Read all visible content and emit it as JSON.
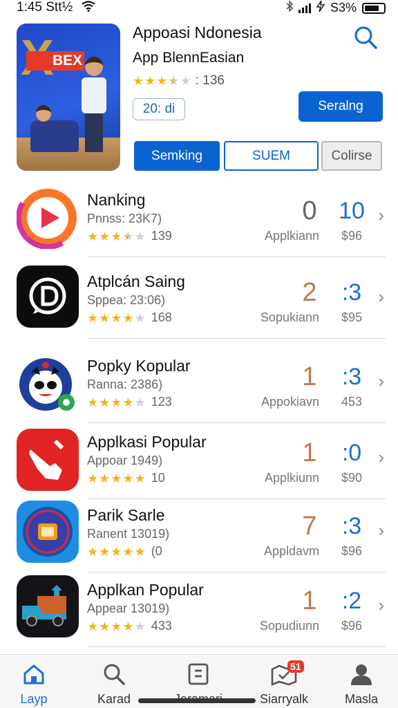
{
  "status": {
    "time": "1:45 Stt½",
    "battery_label": "S3%"
  },
  "featured": {
    "title": "Appoasi Ndonesia",
    "subtitle": "App BlennEasian",
    "rating": 3.5,
    "rating_count": ": 136",
    "chip": "20: di",
    "primary_button": "Seralng",
    "segments": [
      "Semking",
      "SUEM",
      "Colirse"
    ],
    "hero_text": "BEX"
  },
  "apps": [
    {
      "name": "Nanking",
      "meta": "Pnnss: 23K7)",
      "rating": 3.5,
      "reviews": "139",
      "rank": "0",
      "rank_color": "#666666",
      "rank_label": "Applkiann",
      "score": "10",
      "price": "$96"
    },
    {
      "name": "Atplcán Saing",
      "meta": "Sppea: 23:06)",
      "rating": 4,
      "reviews": "168",
      "rank": "2",
      "rank_color": "#c07a4a",
      "rank_label": "Sopukiann",
      "score": ":3",
      "price": "$95"
    },
    {
      "name": "Popky Kopular",
      "meta": "Ranna: 2386)",
      "rating": 4,
      "reviews": "123",
      "rank": "1",
      "rank_color": "#c07a4a",
      "rank_label": "Appokiavn",
      "score": ":3",
      "price": "453"
    },
    {
      "name": "Applkasi Popular",
      "meta": "Appoar 1949)",
      "rating": 5,
      "reviews": "10",
      "rank": "1",
      "rank_color": "#c07a4a",
      "rank_label": "Applkiunn",
      "score": ":0",
      "price": "$90"
    },
    {
      "name": "Parik Sarle",
      "meta": "Ranent 13019)",
      "rating": 5,
      "reviews": "(0",
      "rank": "7",
      "rank_color": "#c07a4a",
      "rank_label": "Appldavm",
      "score": ":3",
      "price": "$96"
    },
    {
      "name": "Applkan Popular",
      "meta": "Appear 13019)",
      "rating": 4,
      "reviews": "433",
      "rank": "1",
      "rank_color": "#c07a4a",
      "rank_label": "Sopudiunn",
      "score": ":2",
      "price": "$96"
    }
  ],
  "tabs": [
    {
      "label": "Layp",
      "icon": "home-icon",
      "active": true
    },
    {
      "label": "Karad",
      "icon": "search-icon",
      "active": false
    },
    {
      "label": "Jeramari",
      "icon": "book-icon",
      "active": false
    },
    {
      "label": "Siarryalk",
      "icon": "map-icon",
      "active": false,
      "badge": "51"
    },
    {
      "label": "Masla",
      "icon": "profile-icon",
      "active": false
    }
  ],
  "colors": {
    "accent": "#0b63d1",
    "star": "#f2b51c"
  }
}
